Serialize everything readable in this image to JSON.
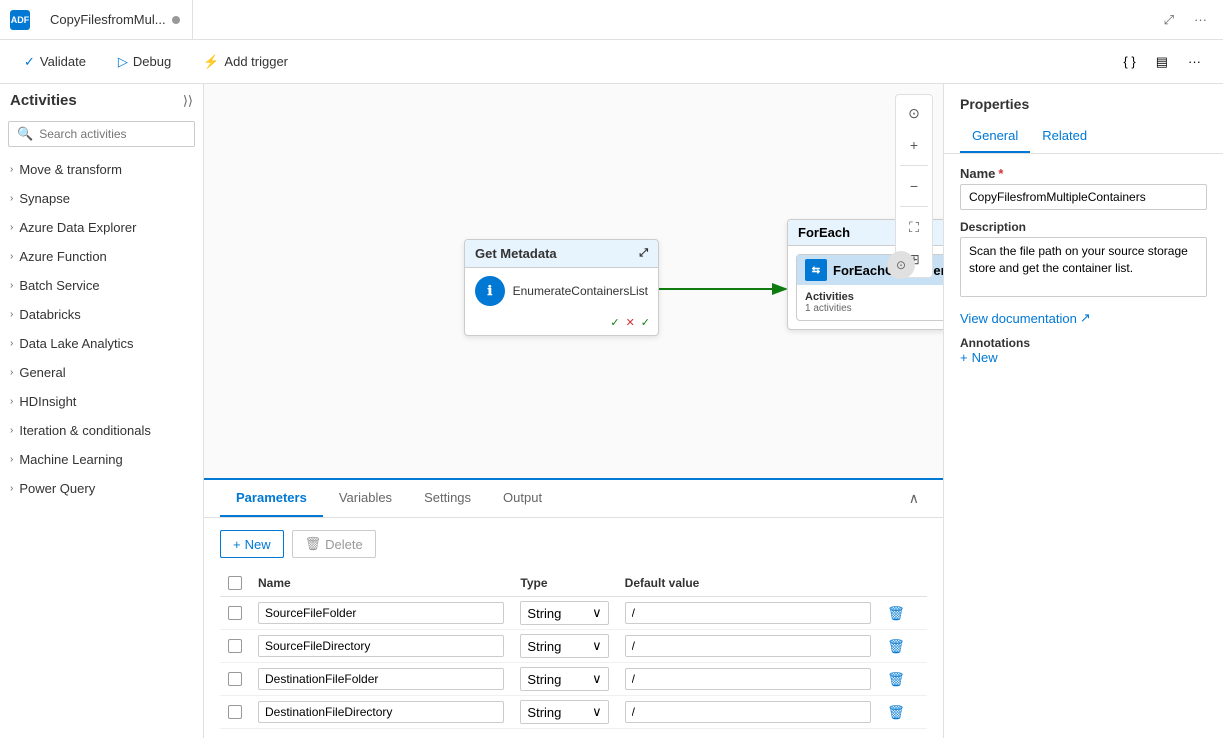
{
  "window": {
    "tab_title": "CopyFilesfromMul...",
    "close_icon": "●"
  },
  "toolbar": {
    "validate_label": "Validate",
    "debug_label": "Debug",
    "add_trigger_label": "Add trigger"
  },
  "sidebar": {
    "title": "Activities",
    "search_placeholder": "Search activities",
    "collapse_icon": "«",
    "filter_icon": "⊞",
    "items": [
      {
        "id": "move-transform",
        "label": "Move & transform"
      },
      {
        "id": "synapse",
        "label": "Synapse"
      },
      {
        "id": "azure-data-explorer",
        "label": "Azure Data Explorer"
      },
      {
        "id": "azure-function",
        "label": "Azure Function"
      },
      {
        "id": "batch-service",
        "label": "Batch Service"
      },
      {
        "id": "databricks",
        "label": "Databricks"
      },
      {
        "id": "data-lake-analytics",
        "label": "Data Lake Analytics"
      },
      {
        "id": "general",
        "label": "General"
      },
      {
        "id": "hdinsight",
        "label": "HDInsight"
      },
      {
        "id": "iteration-conditionals",
        "label": "Iteration & conditionals"
      },
      {
        "id": "machine-learning",
        "label": "Machine Learning"
      },
      {
        "id": "power-query",
        "label": "Power Query"
      }
    ]
  },
  "canvas": {
    "get_metadata_node": {
      "header": "Get Metadata",
      "label": "EnumerateContainersList",
      "icon": "ℹ"
    },
    "foreach_node": {
      "header": "ForEach",
      "inner_label": "ForEachContainer",
      "activities_label": "Activities",
      "activities_count": "1 activities"
    }
  },
  "bottom_panel": {
    "tabs": [
      {
        "id": "parameters",
        "label": "Parameters"
      },
      {
        "id": "variables",
        "label": "Variables"
      },
      {
        "id": "settings",
        "label": "Settings"
      },
      {
        "id": "output",
        "label": "Output"
      }
    ],
    "active_tab": "parameters",
    "new_label": "New",
    "delete_label": "Delete",
    "table": {
      "headers": [
        "Name",
        "Type",
        "Default value"
      ],
      "rows": [
        {
          "name": "SourceFileFolder",
          "type": "String",
          "default": "/"
        },
        {
          "name": "SourceFileDirectory",
          "type": "String",
          "default": "/"
        },
        {
          "name": "DestinationFileFolder",
          "type": "String",
          "default": "/"
        },
        {
          "name": "DestinationFileDirectory",
          "type": "String",
          "default": "/"
        }
      ]
    }
  },
  "properties": {
    "header": "Properties",
    "tabs": [
      {
        "id": "general",
        "label": "General"
      },
      {
        "id": "related",
        "label": "Related"
      }
    ],
    "active_tab": "general",
    "name_label": "Name",
    "name_required": "*",
    "name_value": "CopyFilesfromMultipleContainers",
    "description_label": "Description",
    "description_value": "Scan the file path on your source storage store and get the container list.",
    "view_docs_label": "View documentation",
    "annotations_label": "Annotations",
    "add_annotation_label": "New"
  }
}
